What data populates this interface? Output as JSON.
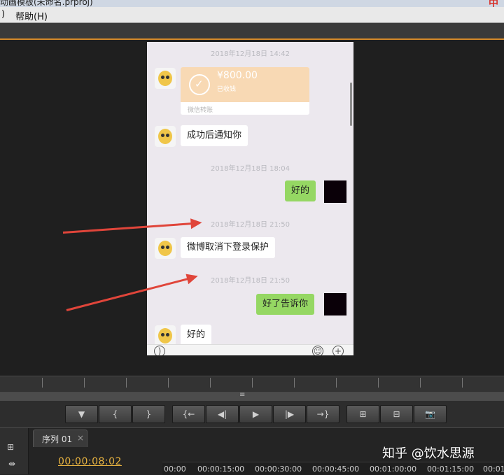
{
  "window": {
    "title": "动画模板(未命名.prproj)",
    "logo": "中"
  },
  "menu": {
    "partial_item": ")",
    "help": "帮助(H)"
  },
  "chat": {
    "timestamps": [
      "2018年12月18日 14:42",
      "2018年12月18日 18:04",
      "2018年12月18日 21:50",
      "2018年12月18日 21:50"
    ],
    "transfer": {
      "amount": "¥800.00",
      "status": "已收钱",
      "label": "微信转账"
    },
    "messages": {
      "m1": "成功后通知你",
      "m2": "好的",
      "m3": "微博取消下登录保护",
      "m4": "好了告诉你",
      "m5": "好的"
    },
    "input_icons": {
      "voice": "voice-icon",
      "emoji": "emoji-icon",
      "plus": "plus-icon"
    }
  },
  "annotation_color": "#e0453a",
  "transport": {
    "buttons": [
      "▼",
      "{",
      "}",
      "{←",
      "◀|",
      "▶",
      "|▶",
      "→}",
      "⊞",
      "⊟",
      "📷"
    ]
  },
  "sequence": {
    "tab_label": "序列 01",
    "close": "×",
    "timecode": "00:00:08:02"
  },
  "timeline": {
    "ticks": [
      "00:00",
      "00:00:15:00",
      "00:00:30:00",
      "00:00:45:00",
      "00:01:00:00",
      "00:01:15:00",
      "00:01:"
    ]
  },
  "watermark": "知乎 @饮水思源"
}
